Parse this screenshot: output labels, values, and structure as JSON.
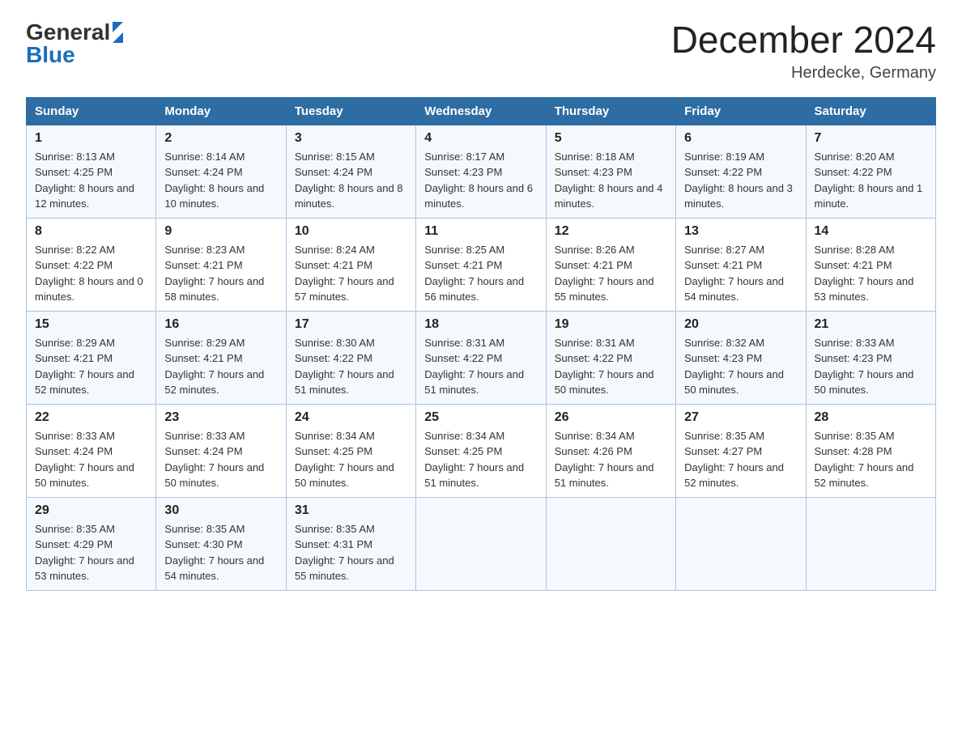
{
  "logo": {
    "text_general": "General",
    "text_blue": "Blue"
  },
  "header": {
    "title": "December 2024",
    "subtitle": "Herdecke, Germany"
  },
  "weekdays": [
    "Sunday",
    "Monday",
    "Tuesday",
    "Wednesday",
    "Thursday",
    "Friday",
    "Saturday"
  ],
  "weeks": [
    [
      {
        "day": "1",
        "sunrise": "8:13 AM",
        "sunset": "4:25 PM",
        "daylight": "8 hours and 12 minutes."
      },
      {
        "day": "2",
        "sunrise": "8:14 AM",
        "sunset": "4:24 PM",
        "daylight": "8 hours and 10 minutes."
      },
      {
        "day": "3",
        "sunrise": "8:15 AM",
        "sunset": "4:24 PM",
        "daylight": "8 hours and 8 minutes."
      },
      {
        "day": "4",
        "sunrise": "8:17 AM",
        "sunset": "4:23 PM",
        "daylight": "8 hours and 6 minutes."
      },
      {
        "day": "5",
        "sunrise": "8:18 AM",
        "sunset": "4:23 PM",
        "daylight": "8 hours and 4 minutes."
      },
      {
        "day": "6",
        "sunrise": "8:19 AM",
        "sunset": "4:22 PM",
        "daylight": "8 hours and 3 minutes."
      },
      {
        "day": "7",
        "sunrise": "8:20 AM",
        "sunset": "4:22 PM",
        "daylight": "8 hours and 1 minute."
      }
    ],
    [
      {
        "day": "8",
        "sunrise": "8:22 AM",
        "sunset": "4:22 PM",
        "daylight": "8 hours and 0 minutes."
      },
      {
        "day": "9",
        "sunrise": "8:23 AM",
        "sunset": "4:21 PM",
        "daylight": "7 hours and 58 minutes."
      },
      {
        "day": "10",
        "sunrise": "8:24 AM",
        "sunset": "4:21 PM",
        "daylight": "7 hours and 57 minutes."
      },
      {
        "day": "11",
        "sunrise": "8:25 AM",
        "sunset": "4:21 PM",
        "daylight": "7 hours and 56 minutes."
      },
      {
        "day": "12",
        "sunrise": "8:26 AM",
        "sunset": "4:21 PM",
        "daylight": "7 hours and 55 minutes."
      },
      {
        "day": "13",
        "sunrise": "8:27 AM",
        "sunset": "4:21 PM",
        "daylight": "7 hours and 54 minutes."
      },
      {
        "day": "14",
        "sunrise": "8:28 AM",
        "sunset": "4:21 PM",
        "daylight": "7 hours and 53 minutes."
      }
    ],
    [
      {
        "day": "15",
        "sunrise": "8:29 AM",
        "sunset": "4:21 PM",
        "daylight": "7 hours and 52 minutes."
      },
      {
        "day": "16",
        "sunrise": "8:29 AM",
        "sunset": "4:21 PM",
        "daylight": "7 hours and 52 minutes."
      },
      {
        "day": "17",
        "sunrise": "8:30 AM",
        "sunset": "4:22 PM",
        "daylight": "7 hours and 51 minutes."
      },
      {
        "day": "18",
        "sunrise": "8:31 AM",
        "sunset": "4:22 PM",
        "daylight": "7 hours and 51 minutes."
      },
      {
        "day": "19",
        "sunrise": "8:31 AM",
        "sunset": "4:22 PM",
        "daylight": "7 hours and 50 minutes."
      },
      {
        "day": "20",
        "sunrise": "8:32 AM",
        "sunset": "4:23 PM",
        "daylight": "7 hours and 50 minutes."
      },
      {
        "day": "21",
        "sunrise": "8:33 AM",
        "sunset": "4:23 PM",
        "daylight": "7 hours and 50 minutes."
      }
    ],
    [
      {
        "day": "22",
        "sunrise": "8:33 AM",
        "sunset": "4:24 PM",
        "daylight": "7 hours and 50 minutes."
      },
      {
        "day": "23",
        "sunrise": "8:33 AM",
        "sunset": "4:24 PM",
        "daylight": "7 hours and 50 minutes."
      },
      {
        "day": "24",
        "sunrise": "8:34 AM",
        "sunset": "4:25 PM",
        "daylight": "7 hours and 50 minutes."
      },
      {
        "day": "25",
        "sunrise": "8:34 AM",
        "sunset": "4:25 PM",
        "daylight": "7 hours and 51 minutes."
      },
      {
        "day": "26",
        "sunrise": "8:34 AM",
        "sunset": "4:26 PM",
        "daylight": "7 hours and 51 minutes."
      },
      {
        "day": "27",
        "sunrise": "8:35 AM",
        "sunset": "4:27 PM",
        "daylight": "7 hours and 52 minutes."
      },
      {
        "day": "28",
        "sunrise": "8:35 AM",
        "sunset": "4:28 PM",
        "daylight": "7 hours and 52 minutes."
      }
    ],
    [
      {
        "day": "29",
        "sunrise": "8:35 AM",
        "sunset": "4:29 PM",
        "daylight": "7 hours and 53 minutes."
      },
      {
        "day": "30",
        "sunrise": "8:35 AM",
        "sunset": "4:30 PM",
        "daylight": "7 hours and 54 minutes."
      },
      {
        "day": "31",
        "sunrise": "8:35 AM",
        "sunset": "4:31 PM",
        "daylight": "7 hours and 55 minutes."
      },
      null,
      null,
      null,
      null
    ]
  ],
  "labels": {
    "sunrise_prefix": "Sunrise: ",
    "sunset_prefix": "Sunset: ",
    "daylight_prefix": "Daylight: "
  }
}
